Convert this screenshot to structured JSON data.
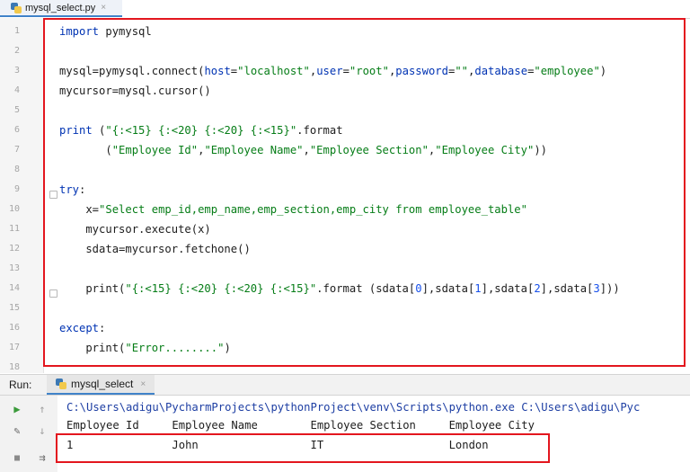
{
  "editor_tab": {
    "label": "mysql_select.py",
    "close": "×"
  },
  "line_numbers": [
    "1",
    "2",
    "3",
    "4",
    "5",
    "6",
    "7",
    "8",
    "9",
    "10",
    "11",
    "12",
    "13",
    "14",
    "15",
    "16",
    "17",
    "18"
  ],
  "code": {
    "l1_kw": "import",
    "l1_rest": " pymysql",
    "l3_a": "mysql=pymysql.connect(",
    "l3_p1": "host",
    "l3_eq1": "=",
    "l3_s1": "\"localhost\"",
    "l3_c1": ",",
    "l3_p2": "user",
    "l3_eq2": "=",
    "l3_s2": "\"root\"",
    "l3_c2": ",",
    "l3_p3": "password",
    "l3_eq3": "=",
    "l3_s3": "\"\"",
    "l3_c3": ",",
    "l3_p4": "database",
    "l3_eq4": "=",
    "l3_s4": "\"employee\"",
    "l3_end": ")",
    "l4": "mycursor=mysql.cursor()",
    "l6_kw": "print",
    "l6_a": " (",
    "l6_s": "\"{:<15} {:<20} {:<20} {:<15}\"",
    "l6_b": ".format",
    "l7_a": "       (",
    "l7_s1": "\"Employee Id\"",
    "l7_c1": ",",
    "l7_s2": "\"Employee Name\"",
    "l7_c2": ",",
    "l7_s3": "\"Employee Section\"",
    "l7_c3": ",",
    "l7_s4": "\"Employee City\"",
    "l7_end": "))",
    "l9_kw": "try",
    "l9_end": ":",
    "l10_a": "    x=",
    "l10_s": "\"Select emp_id,emp_name,emp_section,emp_city from employee_table\"",
    "l11": "    mycursor.execute(x)",
    "l12": "    sdata=mycursor.fetchone()",
    "l14_a": "    print(",
    "l14_s": "\"{:<15} {:<20} {:<20} {:<15}\"",
    "l14_b": ".format (sdata[",
    "l14_n0": "0",
    "l14_c": "],sdata[",
    "l14_n1": "1",
    "l14_d": "],sdata[",
    "l14_n2": "2",
    "l14_e": "],sdata[",
    "l14_n3": "3",
    "l14_end": "]))",
    "l16_kw": "except",
    "l16_end": ":",
    "l17_a": "    print(",
    "l17_s": "\"Error........\"",
    "l17_end": ")"
  },
  "run_panel": {
    "label": "Run:",
    "tab": "mysql_select",
    "close": "×"
  },
  "console": {
    "command": "C:\\Users\\adigu\\PycharmProjects\\pythonProject\\venv\\Scripts\\python.exe C:\\Users\\adigu\\Pyc",
    "header": "Employee Id     Employee Name        Employee Section     Employee City",
    "row": "1               John                 IT                   London"
  },
  "colors": {
    "highlight_box": "#e3161e",
    "keyword": "#0033b3",
    "string": "#067d17",
    "number": "#1750eb"
  }
}
